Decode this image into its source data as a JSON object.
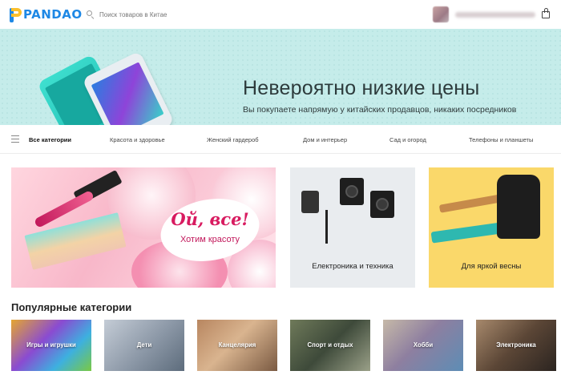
{
  "header": {
    "logo_text": "PANDAO",
    "search_placeholder": "Поиск товаров в Китае"
  },
  "hero": {
    "title": "Невероятно низкие цены",
    "subtitle": "Вы покупаете напрямую у китайских продавцов, никаких посредников",
    "slides_total": 4,
    "slide_active": 2
  },
  "categories_nav": {
    "all": "Все категории",
    "items": [
      "Красота и здоровье",
      "Женский гардероб",
      "Дом и интерьер",
      "Сад и огород",
      "Телефоны и планшеты"
    ]
  },
  "promos": {
    "beauty": {
      "title": "Ой, все!",
      "subtitle": "Хотим красоту"
    },
    "electronics": {
      "caption": "Електроника и техника"
    },
    "spring": {
      "caption": "Для яркой весны"
    }
  },
  "popular": {
    "title": "Популярные категории",
    "items": [
      "Игры и игрушки",
      "Дети",
      "Канцелярия",
      "Спорт и отдых",
      "Хобби",
      "Электроника"
    ]
  },
  "colors": {
    "brand_blue": "#1e88e5",
    "brand_yellow": "#fbc02d",
    "hero_bg": "#c5ecea",
    "promo_pink": "#d81b60",
    "spring_bg": "#fad86a"
  }
}
